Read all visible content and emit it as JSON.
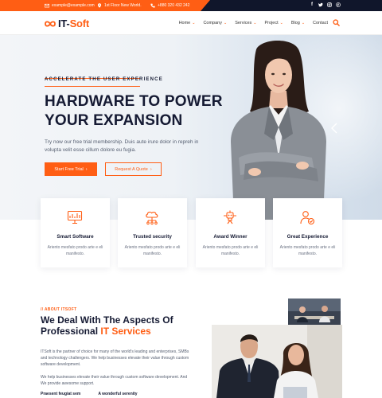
{
  "topbar": {
    "email": "example@example.com",
    "address": "1st Floor New World.",
    "phone": "+880 320 432 242",
    "social": [
      "f",
      "t",
      "ig",
      "p"
    ]
  },
  "header": {
    "logo_main": "IT-",
    "logo_accent": "Soft",
    "nav": [
      {
        "label": "Home",
        "has_dropdown": true
      },
      {
        "label": "Company",
        "has_dropdown": true
      },
      {
        "label": "Services",
        "has_dropdown": true
      },
      {
        "label": "Project",
        "has_dropdown": true
      },
      {
        "label": "Blog",
        "has_dropdown": true
      },
      {
        "label": "Contact",
        "has_dropdown": false
      }
    ],
    "search_icon": "search-icon"
  },
  "hero": {
    "eyebrow": "ACCELERATE THE USER EXPERIENCE",
    "title_line1": "HARDWARE TO POWER",
    "title_line2": "YOUR EXPANSION",
    "text": "Try now our free trial membership. Duis aute irure dolor in repreh in volupta velit esse cillum dolore eu fugia.",
    "primary_button": "Start Free Trial",
    "secondary_button": "Request A Quote"
  },
  "features": [
    {
      "icon": "monitor-chart-icon",
      "title": "Smart Software",
      "text": "Ariento mesfato prodo arte e eli manifesto."
    },
    {
      "icon": "cloud-network-icon",
      "title": "Trusted security",
      "text": "Ariento mesfato prodo arte e eli manifesto."
    },
    {
      "icon": "award-robot-icon",
      "title": "Award Winner",
      "text": "Ariento mesfato prodo arte e eli manifesto."
    },
    {
      "icon": "user-support-icon",
      "title": "Great Experience",
      "text": "Ariento mesfato prodo arte e eli manifesto."
    }
  ],
  "about": {
    "eyebrow": "// ABOUT ITSOFT",
    "title_line1": "We Deal With The Aspects Of",
    "title_line2_prefix": "Professional ",
    "title_line2_highlight": "IT Services",
    "p1": "ITSoft is the partner of choice for many of the world's leading and enterprises, SMBs and technology challengers. We help businesses elevate their value through custom software development.",
    "p2": "We help businesses elevate their value through custom software development. And We provide awesome support.",
    "list": [
      "Praesent feugiat sem",
      "A wonderful serenity"
    ]
  },
  "colors": {
    "accent": "#ff5e14",
    "dark": "#10162b",
    "text": "#151a33"
  }
}
